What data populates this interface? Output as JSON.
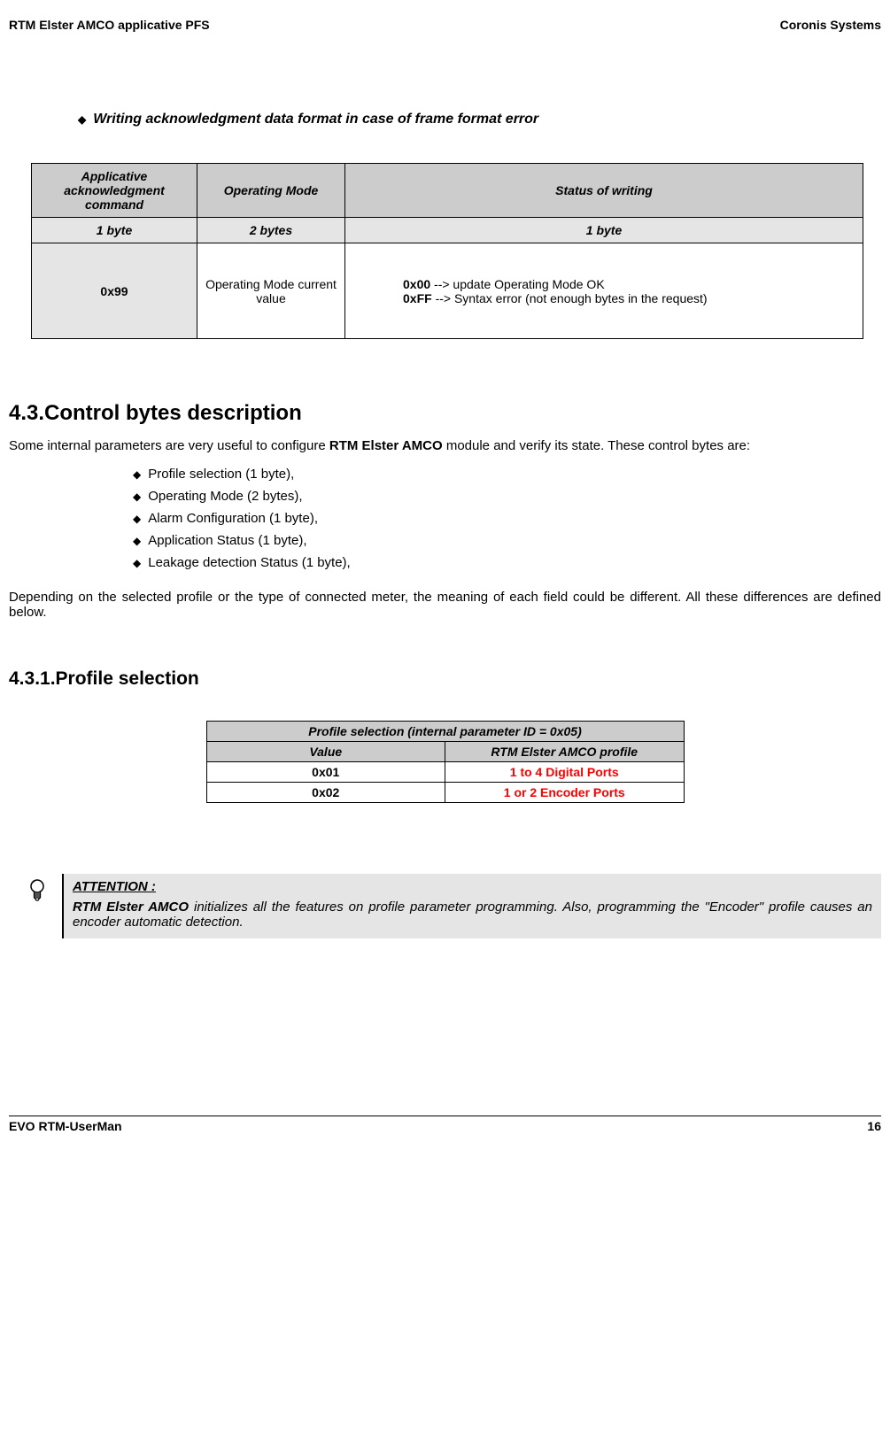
{
  "header": {
    "left": "RTM Elster AMCO applicative PFS",
    "right": "Coronis Systems"
  },
  "section_sub": "Writing acknowledgment data format in case of frame format error",
  "table1": {
    "h1": "Applicative acknowledgment command",
    "h2": "Operating Mode",
    "h3": "Status of writing",
    "r2c1": "1 byte",
    "r2c2": "2 bytes",
    "r2c3": "1 byte",
    "r3c1": "0x99",
    "r3c2": "Operating Mode current value",
    "status_b1": "0x00",
    "status_t1": " --> update Operating Mode OK",
    "status_b2": "0xFF",
    "status_t2": " --> Syntax error (not enough bytes in the request)"
  },
  "h2": "4.3.Control bytes description",
  "para1_a": "Some internal parameters are very useful to configure ",
  "para1_b": "RTM Elster AMCO",
  "para1_c": " module and verify its state. These control bytes are:",
  "bullets": {
    "b1": "Profile selection (1 byte),",
    "b2": "Operating Mode (2 bytes),",
    "b3": "Alarm Configuration (1 byte),",
    "b4": "Application Status (1 byte),",
    "b5": "Leakage detection Status (1 byte),"
  },
  "para2": "Depending on the selected profile or the type of connected meter, the meaning of each field could be different. All these differences are defined below.",
  "h3": "4.3.1.Profile selection",
  "table2": {
    "head": "Profile selection (internal parameter ID = 0x05)",
    "h1": "Value",
    "h2": "RTM  Elster AMCO  profile",
    "r1c1": "0x01",
    "r1c2": "1 to 4  Digital Ports",
    "r2c1": "0x02",
    "r2c2": "1 or 2  Encoder Ports"
  },
  "attn": {
    "title": "ATTENTION :",
    "b1": "RTM Elster AMCO",
    "t1": " initializes all the features on profile parameter programming. Also, programming the \"Encoder\" profile causes an encoder automatic detection."
  },
  "footer": {
    "left": "EVO RTM-UserMan",
    "right": "16"
  }
}
